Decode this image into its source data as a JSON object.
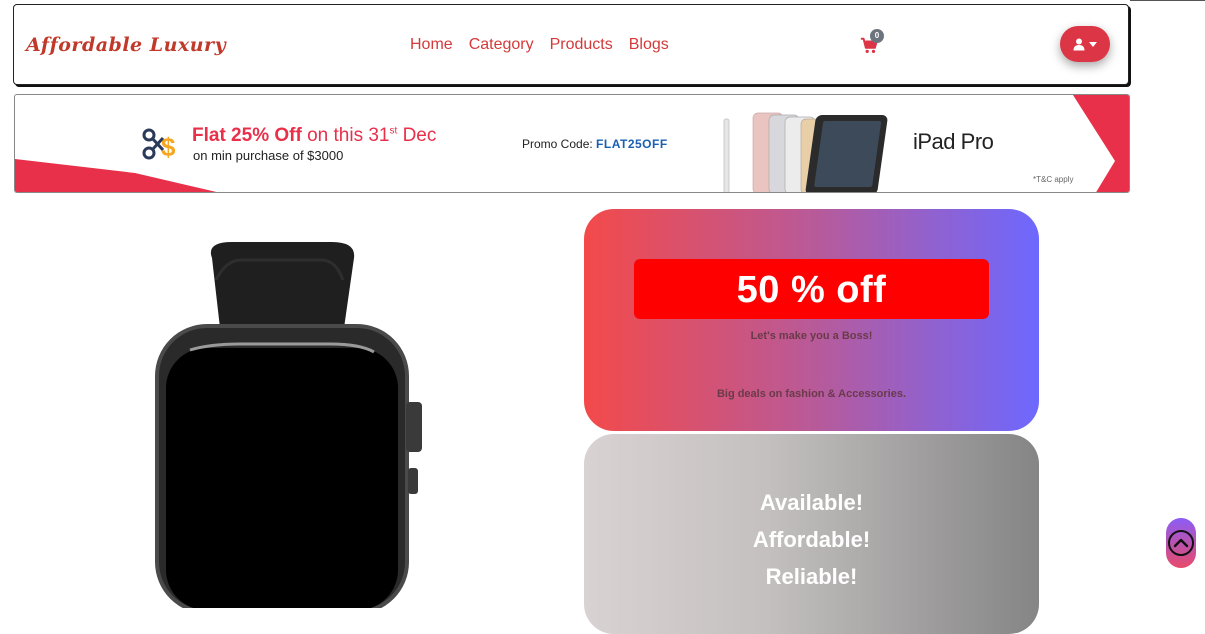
{
  "navbar": {
    "brand": "Affordable Luxury",
    "links": [
      "Home",
      "Category",
      "Products",
      "Blogs"
    ],
    "cart_count": "0"
  },
  "banner": {
    "flat_text": "Flat 25% Off",
    "on_this": "on this 31",
    "superscript": "st",
    "month": "Dec",
    "min_purchase": "on min purchase of $3000",
    "promo_label": "Promo Code:",
    "promo_code": "FLAT25OFF",
    "product": "iPad Pro",
    "terms": "*T&C apply"
  },
  "card1": {
    "discount": "50 % off",
    "tagline": "Let's make you a Boss!",
    "deals": "Big deals on fashion & Accessories."
  },
  "card2": {
    "slogans": [
      "Available!",
      "Affordable!",
      "Reliable!"
    ]
  },
  "colors": {
    "brand_red": "#dc3545",
    "promo_blue": "#1a5fb4",
    "offer_red": "#ff0000"
  },
  "icons": [
    "shopping-cart-icon",
    "user-icon",
    "caret-down-icon",
    "discount-icon",
    "chevron-up-icon"
  ]
}
